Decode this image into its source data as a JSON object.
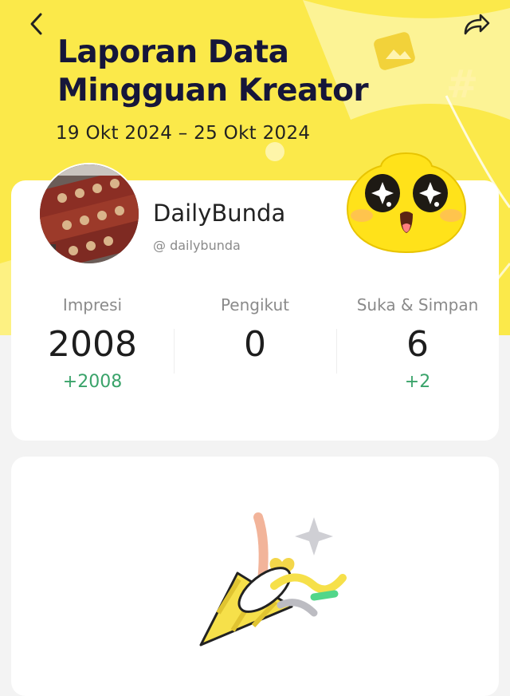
{
  "header": {
    "title_line1": "Laporan Data",
    "title_line2": "Mingguan Kreator",
    "date_range": "19 Okt 2024 – 25 Okt 2024"
  },
  "profile": {
    "name": "DailyBunda",
    "handle": "@ dailybunda"
  },
  "stats": [
    {
      "label": "Impresi",
      "value": "2008",
      "delta": "+2008"
    },
    {
      "label": "Pengikut",
      "value": "0",
      "delta": ""
    },
    {
      "label": "Suka & Simpan",
      "value": "6",
      "delta": "+2"
    }
  ],
  "colors": {
    "hero": "#fbe94a",
    "title": "#16163a",
    "delta": "#3aa36a"
  }
}
